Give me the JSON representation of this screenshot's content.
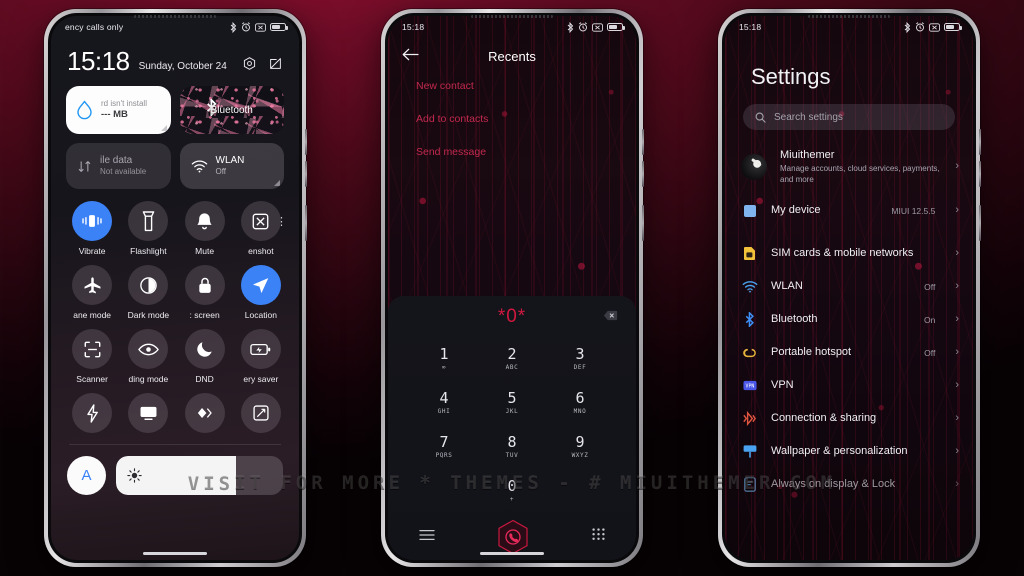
{
  "watermark": {
    "text": "VISIT  FOR  MORE  *  THEMES   -  # MIUITHEMER",
    "suffix": ".COM",
    "dot": ""
  },
  "phone1": {
    "statusbar": {
      "carrier": "ency calls only",
      "icons": [
        "bluetooth-icon",
        "alarm-icon",
        "dnd-icon",
        "battery-icon"
      ]
    },
    "clock": {
      "time": "15:18",
      "date": "Sunday, October 24"
    },
    "header_icons": [
      "settings-gear-icon",
      "edit-icon"
    ],
    "widgets": [
      {
        "name": "cleaner",
        "line1": "rd isn't install",
        "line2": "--- MB",
        "icon": "water-drop-icon"
      },
      {
        "name": "bluetooth",
        "label": "Bluetooth",
        "icon": "bluetooth-icon"
      }
    ],
    "big_tiles": [
      {
        "title": "ile data",
        "sub": "Not available",
        "icon": "mobile-data-icon",
        "state": "off"
      },
      {
        "title": "WLAN",
        "sub": "Off",
        "icon": "wifi-icon",
        "state": "off"
      }
    ],
    "toggles": [
      [
        {
          "label": "Vibrate",
          "icon": "vibrate-icon",
          "on": true
        },
        {
          "label": "Flashlight",
          "icon": "flashlight-icon",
          "on": false
        },
        {
          "label": "Mute",
          "icon": "bell-icon",
          "on": false
        },
        {
          "label": "enshot",
          "icon": "screenshot-icon",
          "on": false
        }
      ],
      [
        {
          "label": "ane mode",
          "icon": "airplane-icon",
          "on": false
        },
        {
          "label": "Dark mode",
          "icon": "contrast-icon",
          "on": false
        },
        {
          "label": ": screen",
          "icon": "lock-icon",
          "on": false
        },
        {
          "label": "Location",
          "icon": "location-arrow-icon",
          "on": true
        }
      ],
      [
        {
          "label": "Scanner",
          "icon": "scan-frame-icon",
          "on": false
        },
        {
          "label": "ding mode",
          "icon": "eye-icon",
          "on": false
        },
        {
          "label": "DND",
          "icon": "moon-icon",
          "on": false
        },
        {
          "label": "ery saver",
          "icon": "battery-saver-icon",
          "on": false
        }
      ],
      [
        {
          "label": "",
          "icon": "lightning-icon",
          "on": false
        },
        {
          "label": "",
          "icon": "cast-screen-icon",
          "on": false
        },
        {
          "label": "",
          "icon": "nfc-icon",
          "on": false
        },
        {
          "label": "",
          "icon": "rotate-screen-icon",
          "on": false
        }
      ]
    ],
    "brightness": {
      "auto_label": "A",
      "level": 72,
      "icon": "sun-icon"
    }
  },
  "phone2": {
    "statusbar": {
      "time": "15:18",
      "icons": [
        "bluetooth-icon",
        "alarm-icon",
        "dnd-icon",
        "battery-icon"
      ]
    },
    "title": "Recents",
    "back_icon": "arrow-left-icon",
    "menu": [
      "New contact",
      "Add to contacts",
      "Send message"
    ],
    "dialed_number": "*0*",
    "delete_icon": "backspace-icon",
    "keys": [
      {
        "digit": "1",
        "letters": "∞"
      },
      {
        "digit": "2",
        "letters": "ABC"
      },
      {
        "digit": "3",
        "letters": "DEF"
      },
      {
        "digit": "4",
        "letters": "GHI"
      },
      {
        "digit": "5",
        "letters": "JKL"
      },
      {
        "digit": "6",
        "letters": "MNO"
      },
      {
        "digit": "7",
        "letters": "PQRS"
      },
      {
        "digit": "8",
        "letters": "TUV"
      },
      {
        "digit": "9",
        "letters": "WXYZ"
      },
      {
        "digit": "0",
        "letters": "+"
      }
    ],
    "nav": [
      "menu-lines-icon",
      "call-button-icon",
      "keypad-grid-icon"
    ]
  },
  "phone3": {
    "statusbar": {
      "time": "15:18",
      "icons": [
        "bluetooth-icon",
        "alarm-icon",
        "dnd-icon",
        "battery-icon"
      ]
    },
    "title": "Settings",
    "search": {
      "placeholder": "Search settings",
      "icon": "search-icon"
    },
    "account": {
      "name": "Miuithemer",
      "sub": "Manage accounts, cloud services, payments, and more",
      "icon": "user-avatar"
    },
    "items": [
      {
        "label": "My device",
        "value": "MIUI 12.5.5",
        "icon": "device-icon",
        "color": "#7fb4ee",
        "gap_after": true
      },
      {
        "label": "SIM cards & mobile networks",
        "value": "",
        "icon": "sim-icon",
        "color": "#f2c23b"
      },
      {
        "label": "WLAN",
        "value": "Off",
        "icon": "wifi-icon",
        "color": "#4aa3f0"
      },
      {
        "label": "Bluetooth",
        "value": "On",
        "icon": "bluetooth-icon",
        "color": "#3e8ef7"
      },
      {
        "label": "Portable hotspot",
        "value": "Off",
        "icon": "hotspot-icon",
        "color": "#e8b53c"
      },
      {
        "label": "VPN",
        "value": "",
        "icon": "vpn-icon",
        "color": "#4a56e8"
      },
      {
        "label": "Connection & sharing",
        "value": "",
        "icon": "sharing-icon",
        "color": "#e0553f"
      },
      {
        "label": "Wallpaper & personalization",
        "value": "",
        "icon": "wallpaper-icon",
        "color": "#4aa3f0"
      },
      {
        "label": "Always on display & Lock",
        "value": "",
        "icon": "aod-icon",
        "color": "#6fb0e8"
      }
    ],
    "colors": {
      "accent": "#c2294e",
      "background": "#0c0610"
    }
  }
}
